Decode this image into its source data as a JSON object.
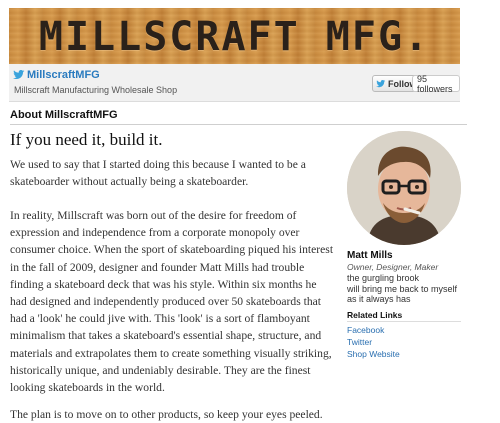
{
  "banner": {
    "title": "MILLSCRAFT MFG."
  },
  "profile": {
    "handle": "MillscraftMFG",
    "description": "Millscraft Manufacturing Wholesale Shop",
    "follow_label": "Follow",
    "followers": "95 followers"
  },
  "about": {
    "heading": "About MillscraftMFG",
    "headline": "If you need it, build it.",
    "paragraphs": [
      "We used to say that I started doing this because I wanted to be a skateboarder without actually being a skateboarder.",
      "In reality, Millscraft was born out of the desire for freedom of expression and independence from a corporate monopoly over consumer choice. When the sport of skateboarding piqued his interest in the fall of 2009, designer and founder Matt Mills had trouble finding a skateboard deck that was his style. Within six months he had designed and independently produced over 50 skateboards that had a 'look' he could jive with. This 'look' is a sort of flamboyant minimalism that takes a skateboard's essential shape, structure, and materials and extrapolates them to create something visually striking, historically unique, and undeniably desirable. They are the finest looking skateboards in the world.",
      "The plan is to move on to other products, so keep your eyes peeled."
    ]
  },
  "person": {
    "name": "Matt Mills",
    "role": "Owner, Designer, Maker",
    "quote_lines": [
      "the gurgling brook",
      "will bring me back to myself",
      "as it always has"
    ]
  },
  "related": {
    "heading": "Related Links",
    "links": [
      "Facebook",
      "Twitter",
      "Shop Website"
    ]
  },
  "colors": {
    "link": "#2a7bbf",
    "banner_wood": "#cf9245"
  }
}
